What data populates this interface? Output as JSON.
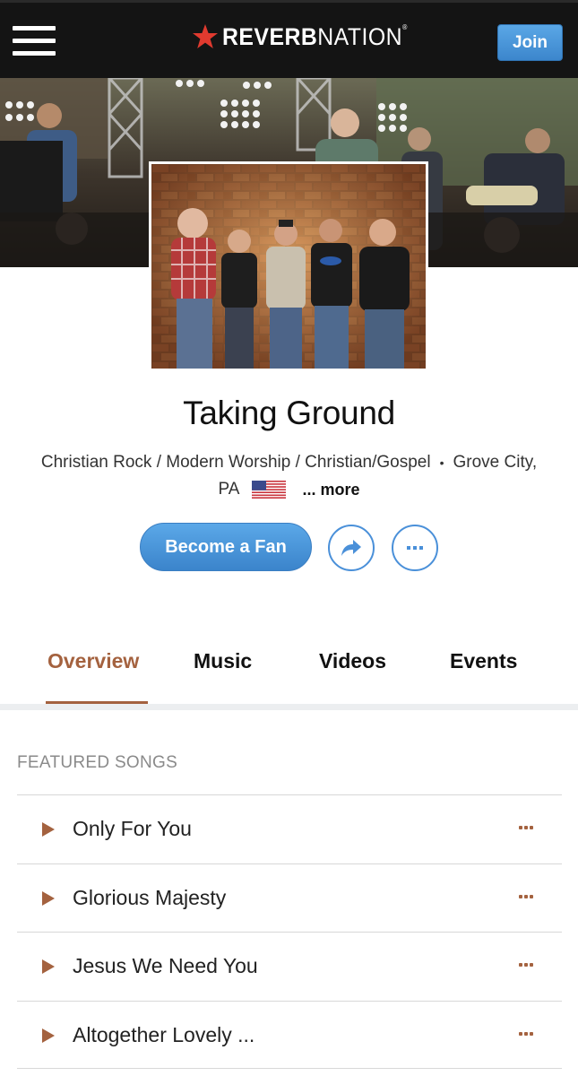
{
  "header": {
    "logo_text_bold": "REVERB",
    "logo_text_light": "NATION",
    "logo_reg": "®",
    "join_label": "Join",
    "brand_red": "#e03a2f",
    "brand_blue": "#4a90d9"
  },
  "artist": {
    "name": "Taking Ground",
    "genres": "Christian Rock / Modern Worship / Christian/Gospel",
    "separator": "•",
    "location_part1": "Grove City,",
    "location_part2": "PA",
    "more_label": "... more"
  },
  "actions": {
    "become_fan_label": "Become a Fan"
  },
  "tabs": [
    {
      "label": "Overview",
      "active": true
    },
    {
      "label": "Music",
      "active": false
    },
    {
      "label": "Videos",
      "active": false
    },
    {
      "label": "Events",
      "active": false
    }
  ],
  "featured": {
    "title": "FEATURED SONGS",
    "songs": [
      {
        "title": "Only For You"
      },
      {
        "title": "Glorious Majesty"
      },
      {
        "title": "Jesus We Need You"
      },
      {
        "title": "Altogether Lovely ..."
      }
    ]
  },
  "accent_color": "#a4623f"
}
